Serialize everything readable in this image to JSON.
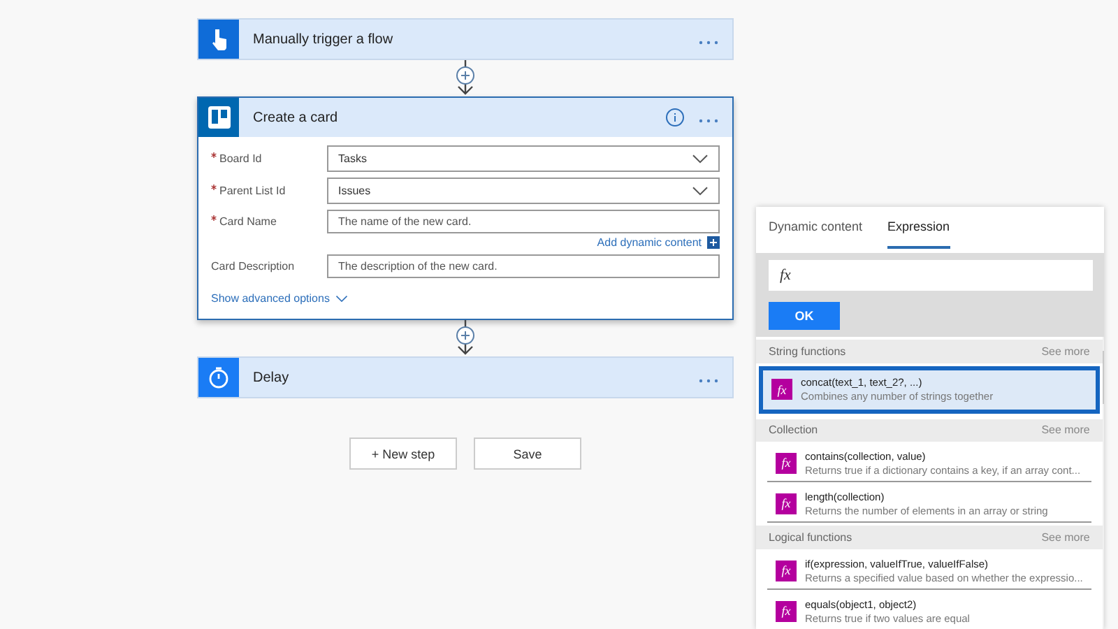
{
  "steps": [
    {
      "kind": "trigger",
      "title": "Manually trigger a flow",
      "selected": false
    },
    {
      "kind": "trello",
      "title": "Create a card",
      "selected": true,
      "fields": [
        {
          "label": "Board Id",
          "required": true,
          "kind": "dropdown",
          "value": "Tasks"
        },
        {
          "label": "Parent List Id",
          "required": true,
          "kind": "dropdown",
          "value": "Issues"
        },
        {
          "label": "Card Name",
          "required": true,
          "kind": "text",
          "placeholder": "The name of the new card.",
          "dynamic_link": "Add dynamic content"
        },
        {
          "label": "Card Description",
          "required": false,
          "kind": "text",
          "placeholder": "The description of the new card."
        }
      ],
      "advanced": "Show advanced options"
    },
    {
      "kind": "delay",
      "title": "Delay",
      "selected": false
    }
  ],
  "buttons": [
    "+ New step",
    "Save"
  ],
  "panel": {
    "tabs": [
      {
        "label": "Dynamic content",
        "selected": false
      },
      {
        "label": "Expression",
        "selected": true
      }
    ],
    "input_prefix": "fx",
    "ok": "OK",
    "sections": [
      {
        "title": "String functions",
        "see_more": "See more",
        "items": [
          {
            "icon": "fx",
            "name": "concat(text_1, text_2?, ...)",
            "description": "Combines any number of strings together",
            "selected": true
          }
        ]
      },
      {
        "title": "Collection",
        "see_more": "See more",
        "items": [
          {
            "icon": "fx",
            "name": "contains(collection, value)",
            "description": "Returns true if a dictionary contains a key, if an array cont...",
            "selected": false
          },
          {
            "icon": "fx",
            "name": "length(collection)",
            "description": "Returns the number of elements in an array or string",
            "selected": false
          }
        ]
      },
      {
        "title": "Logical functions",
        "see_more": "See more",
        "items": [
          {
            "icon": "fx",
            "name": "if(expression, valueIfTrue, valueIfFalse)",
            "description": "Returns a specified value based on whether the expressio...",
            "selected": false
          },
          {
            "icon": "fx",
            "name": "equals(object1, object2)",
            "description": "Returns true if two values are equal",
            "selected": false
          }
        ]
      }
    ]
  }
}
